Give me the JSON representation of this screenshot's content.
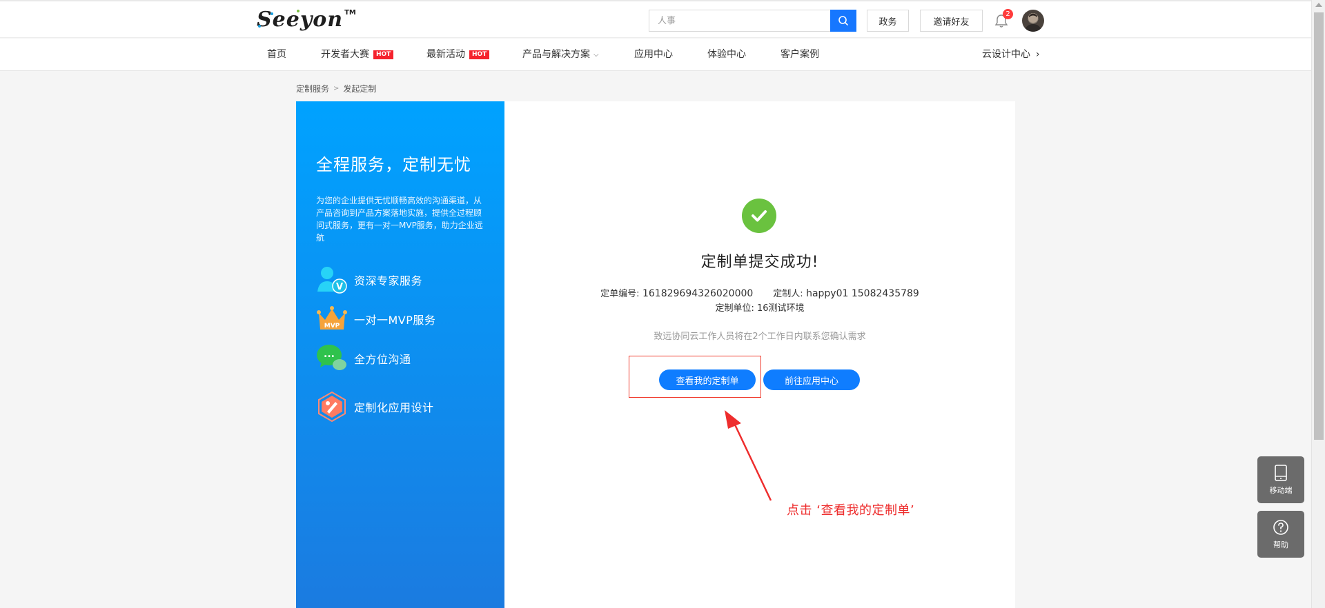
{
  "header": {
    "logo_text": "Seeyon",
    "logo_tm": "TM",
    "search_placeholder": "人事",
    "buttons": [
      "政务",
      "邀请好友"
    ],
    "notification_count": "2"
  },
  "nav": {
    "items": [
      {
        "label": "首页"
      },
      {
        "label": "开发者大赛",
        "badge": "HOT"
      },
      {
        "label": "最新活动",
        "badge": "HOT"
      },
      {
        "label": "产品与解决方案"
      },
      {
        "label": "应用中心"
      },
      {
        "label": "体验中心"
      },
      {
        "label": "客户案例"
      }
    ],
    "right_link": "云设计中心"
  },
  "breadcrumb": {
    "items": [
      "定制服务",
      "发起定制"
    ],
    "separator": ">"
  },
  "promo": {
    "title": "全程服务，定制无忧",
    "description": "为您的企业提供无忧顺畅高效的沟通渠道，从产品咨询到产品方案落地实施，提供全过程顾问式服务，更有一对一MVP服务，助力企业远航",
    "features": [
      {
        "icon": "expert-icon",
        "label": "资深专家服务",
        "badge": "V"
      },
      {
        "icon": "crown-icon",
        "label": "一对一MVP服务",
        "badge": "MVP"
      },
      {
        "icon": "chat-icon",
        "label": "全方位沟通",
        "badge": "..."
      },
      {
        "icon": "design-icon",
        "label": "定制化应用设计"
      }
    ]
  },
  "result": {
    "title": "定制单提交成功!",
    "order_no_label": "定单编号:",
    "order_no": "161829694326020000",
    "customer_label": "定制人:",
    "customer": "happy01 15082435789",
    "unit_label": "定制单位:",
    "unit": "16测试环境",
    "notice": "致远协同云工作人员将在2个工作日内联系您确认需求",
    "view_button": "查看我的定制单",
    "goto_button": "前往应用中心"
  },
  "annotation": {
    "text": "点击 ‘查看我的定制单’"
  },
  "floats": {
    "mobile_label": "移动端",
    "help_label": "帮助"
  },
  "colors": {
    "primary": "#0f7dff",
    "promo_top": "#00a2ff",
    "promo_bottom": "#1b7be0",
    "success": "#6ac23f",
    "hot": "#f5222d",
    "annotation": "#ee2d2d"
  }
}
